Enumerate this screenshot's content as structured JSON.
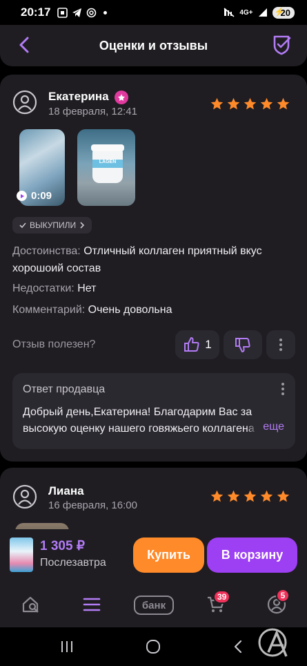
{
  "status_bar": {
    "time": "20:17",
    "network": "4G+",
    "battery": "20"
  },
  "header": {
    "title": "Оценки и отзывы"
  },
  "reviews": [
    {
      "author": "Екатерина",
      "date": "18 февраля, 12:41",
      "rating": 5,
      "media": [
        {
          "type": "video",
          "duration": "0:09"
        },
        {
          "type": "photo",
          "label": "LAGEN"
        }
      ],
      "badge": "ВЫКУПИЛИ",
      "advantages_label": "Достоинства:",
      "advantages": "Отличный коллаген приятный вкус хорошоий состав",
      "disadvantages_label": "Недостатки:",
      "disadvantages": "Нет",
      "comment_label": "Комментарий:",
      "comment": "Очень довольна",
      "useful_question": "Отзыв полезен?",
      "likes": "1",
      "seller_reply": {
        "title": "Ответ продавца",
        "text": "Добрый день,Екатерина! Благодарим Вас за высокую оценку нашего говяжьего коллагена",
        "more": "еще"
      }
    },
    {
      "author": "Лиана",
      "date": "16 февраля, 16:00",
      "rating": 5
    }
  ],
  "buy_bar": {
    "price": "1 305 ₽",
    "delivery": "Послезавтра",
    "buy_label": "Купить",
    "cart_label": "В корзину"
  },
  "tab_bar": {
    "bank_label": "банк",
    "cart_count": "39",
    "profile_count": "5"
  },
  "colors": {
    "accent": "#9d3ff2",
    "buy": "#ff8a2a",
    "star": "#ff8a2a",
    "badge_red": "#f0325a"
  }
}
